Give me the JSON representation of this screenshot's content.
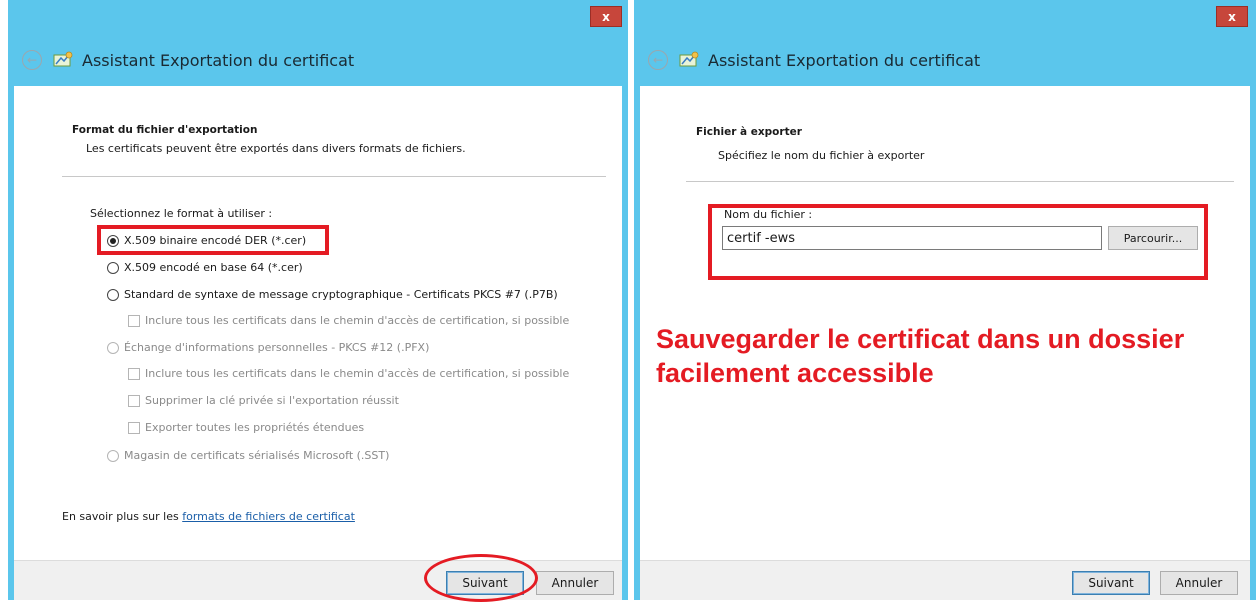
{
  "left": {
    "title": "Assistant Exportation du certificat",
    "section_title": "Format du fichier d'exportation",
    "section_desc": "Les certificats peuvent être exportés dans divers formats de fichiers.",
    "select_label": "Sélectionnez le format à utiliser :",
    "options": [
      {
        "label": "X.509 binaire encodé DER (*.cer)",
        "type": "radio",
        "checked": true,
        "enabled": true
      },
      {
        "label": "X.509 encodé en base 64 (*.cer)",
        "type": "radio",
        "checked": false,
        "enabled": true
      },
      {
        "label": "Standard de syntaxe de message cryptographique - Certificats PKCS #7 (.P7B)",
        "type": "radio",
        "checked": false,
        "enabled": true
      },
      {
        "label": "Inclure tous les certificats dans le chemin d'accès de certification, si possible",
        "type": "checkbox",
        "checked": false,
        "enabled": false
      },
      {
        "label": "Échange d'informations personnelles - PKCS #12 (.PFX)",
        "type": "radio",
        "checked": false,
        "enabled": false
      },
      {
        "label": "Inclure tous les certificats dans le chemin d'accès de certification, si possible",
        "type": "checkbox",
        "checked": false,
        "enabled": false
      },
      {
        "label": "Supprimer la clé privée si l'exportation réussit",
        "type": "checkbox",
        "checked": false,
        "enabled": false
      },
      {
        "label": "Exporter toutes les propriétés étendues",
        "type": "checkbox",
        "checked": false,
        "enabled": false
      },
      {
        "label": "Magasin de certificats sérialisés Microsoft (.SST)",
        "type": "radio",
        "checked": false,
        "enabled": false
      }
    ],
    "learn_more_prefix": "En savoir plus sur les ",
    "learn_more_link": "formats de fichiers de certificat",
    "next_label": "Suivant",
    "cancel_label": "Annuler"
  },
  "right": {
    "title": "Assistant Exportation du certificat",
    "section_title": "Fichier à exporter",
    "section_desc": "Spécifiez le nom du fichier à exporter",
    "filename_label": "Nom du fichier :",
    "filename_value": "certif -ews",
    "browse_label": "Parcourir...",
    "annotation": "Sauvegarder le certificat dans un dossier facilement accessible",
    "next_label": "Suivant",
    "cancel_label": "Annuler"
  },
  "close_label": "x",
  "colors": {
    "title_bar": "#5bc6ec",
    "annotation_red": "#e41b23",
    "close_button": "#c7463b"
  },
  "icons": [
    "back-arrow-icon",
    "certificate-wizard-icon",
    "close-icon"
  ]
}
